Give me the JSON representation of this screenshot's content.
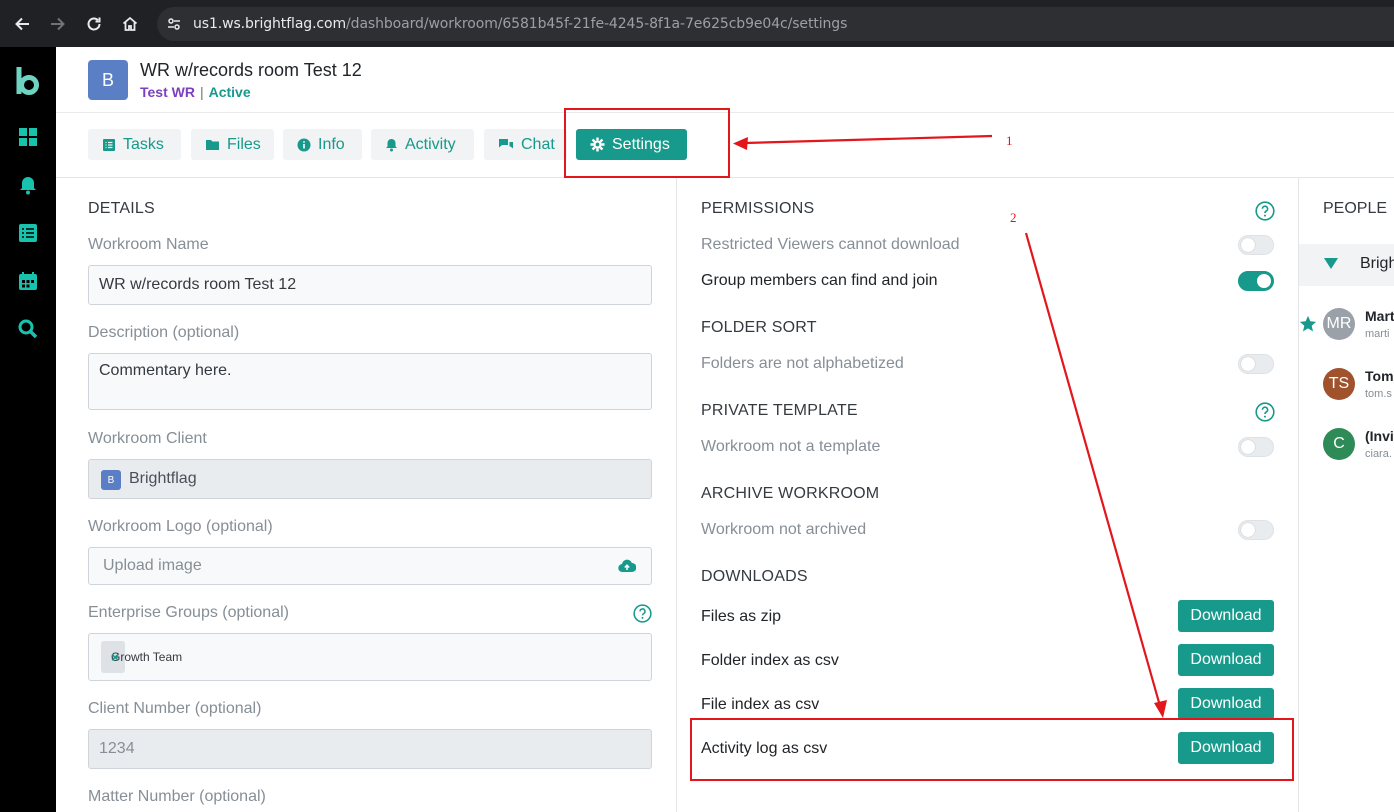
{
  "browser": {
    "url_host": "us1.ws.brightflag.com",
    "url_path": "/dashboard/workroom/6581b45f-21fe-4245-8f1a-7e625cb9e04c/settings"
  },
  "workroom": {
    "avatar_letter": "B",
    "title": "WR w/records room Test 12",
    "client": "Test WR",
    "separator": "|",
    "status": "Active"
  },
  "tabs": [
    {
      "label": "Tasks"
    },
    {
      "label": "Files"
    },
    {
      "label": "Info"
    },
    {
      "label": "Activity"
    },
    {
      "label": "Chat"
    },
    {
      "label": "Settings"
    }
  ],
  "details": {
    "heading": "DETAILS",
    "name_label": "Workroom Name",
    "name_value": "WR w/records room Test 12",
    "description_label": "Description (optional)",
    "description_value": "Commentary here.",
    "client_label": "Workroom Client",
    "client_badge": "B",
    "client_value": "Brightflag",
    "logo_label": "Workroom Logo (optional)",
    "logo_placeholder": "Upload image",
    "groups_label": "Enterprise Groups (optional)",
    "group_chip": "Growth Team",
    "chip_remove": "×",
    "client_number_label": "Client Number (optional)",
    "client_number_value": "1234",
    "matter_number_label": "Matter Number (optional)"
  },
  "permissions": {
    "heading": "PERMISSIONS",
    "restricted_label": "Restricted Viewers cannot download",
    "restricted_on": false,
    "group_join_label": "Group members can find and join",
    "group_join_on": true
  },
  "folder_sort": {
    "heading": "FOLDER SORT",
    "label": "Folders are not alphabetized",
    "on": false
  },
  "private_template": {
    "heading": "PRIVATE TEMPLATE",
    "label": "Workroom not a template",
    "on": false
  },
  "archive": {
    "heading": "ARCHIVE WORKROOM",
    "label": "Workroom not archived",
    "on": false
  },
  "downloads": {
    "heading": "DOWNLOADS",
    "button_label": "Download",
    "items": [
      {
        "label": "Files as zip"
      },
      {
        "label": "Folder index as csv"
      },
      {
        "label": "File index as csv"
      },
      {
        "label": "Activity log as csv"
      }
    ]
  },
  "people": {
    "heading": "PEOPLE",
    "group_name": "Brigh",
    "members": [
      {
        "initials": "MR",
        "name": "Mart",
        "email": "marti",
        "color": "#9aa1a8"
      },
      {
        "initials": "TS",
        "name": "Tom",
        "email": "tom.s",
        "color": "#a0522d"
      },
      {
        "initials": "C",
        "name": "(Invit",
        "email": "ciara.",
        "color": "#2e8b57"
      }
    ]
  },
  "annotations": {
    "num1": "1",
    "num2": "2"
  },
  "colors": {
    "accent": "#17998b",
    "annotation_red": "#e2161b",
    "sidebar_bg": "#000000"
  }
}
